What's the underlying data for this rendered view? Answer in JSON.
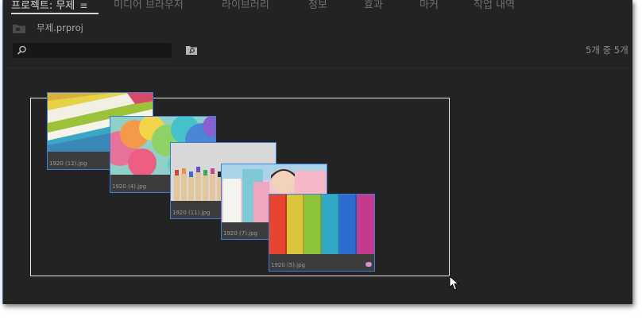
{
  "tabs": [
    {
      "label": "프로젝트: 무제",
      "active": true
    },
    {
      "label": "미디어 브라우저"
    },
    {
      "label": "라이브러리"
    },
    {
      "label": "정보"
    },
    {
      "label": "효과"
    },
    {
      "label": "마커"
    },
    {
      "label": "작업 내역"
    }
  ],
  "project": {
    "name": "무제.prproj",
    "search_value": "",
    "item_count": "5개 중 5개"
  },
  "clips": [
    {
      "name": "1920 (12).jpg"
    },
    {
      "name": "1920 (4).jpg"
    },
    {
      "name": "1920 (11).jpg"
    },
    {
      "name": "1920 (7).jpg"
    },
    {
      "name": "1920 (5).jpg",
      "label_color": "#d98fc2"
    }
  ],
  "colors": {
    "panel_bg": "#232323",
    "selection_border": "#3f7fd2",
    "marquee": "#e6e6e6"
  }
}
